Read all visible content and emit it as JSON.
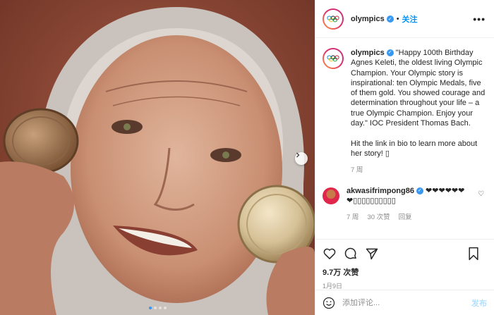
{
  "post": {
    "username": "olympics",
    "follow_label": "关注",
    "more_label": "•••",
    "caption": "\"Happy 100th Birthday Agnes Keleti, the oldest living Olympic Champion. Your Olympic story is inspirational: ten Olympic Medals, five of them gold. You showed courage and determination throughout your life – a true Olympic Champion. Enjoy your day.\" IOC President Thomas Bach.\n\nHit the link in bio to learn more about her story! ▯",
    "caption_time": "7 周",
    "comment": {
      "username": "akwasifrimpong86",
      "text": "❤❤❤❤❤❤ ❤▯▯▯▯▯▯▯▯▯▯",
      "time": "7 周",
      "likes": "30 次赞",
      "reply_label": "回复"
    },
    "likes": "9.7万 次赞",
    "date": "1月9日",
    "comment_placeholder": "添加评论...",
    "post_label": "发布"
  },
  "icons": {
    "logo": "olympic-rings-icon",
    "verified": "verified-badge-icon",
    "next": "chevron-right-icon",
    "like": "heart-icon",
    "comment": "comment-bubble-icon",
    "share": "paper-plane-icon",
    "save": "bookmark-icon",
    "emoji": "smiley-icon"
  },
  "carousel": {
    "count": 4,
    "active": 0
  },
  "colors": {
    "accent": "#0095f6",
    "verified": "#3897f0",
    "muted": "#8e8e8e"
  }
}
